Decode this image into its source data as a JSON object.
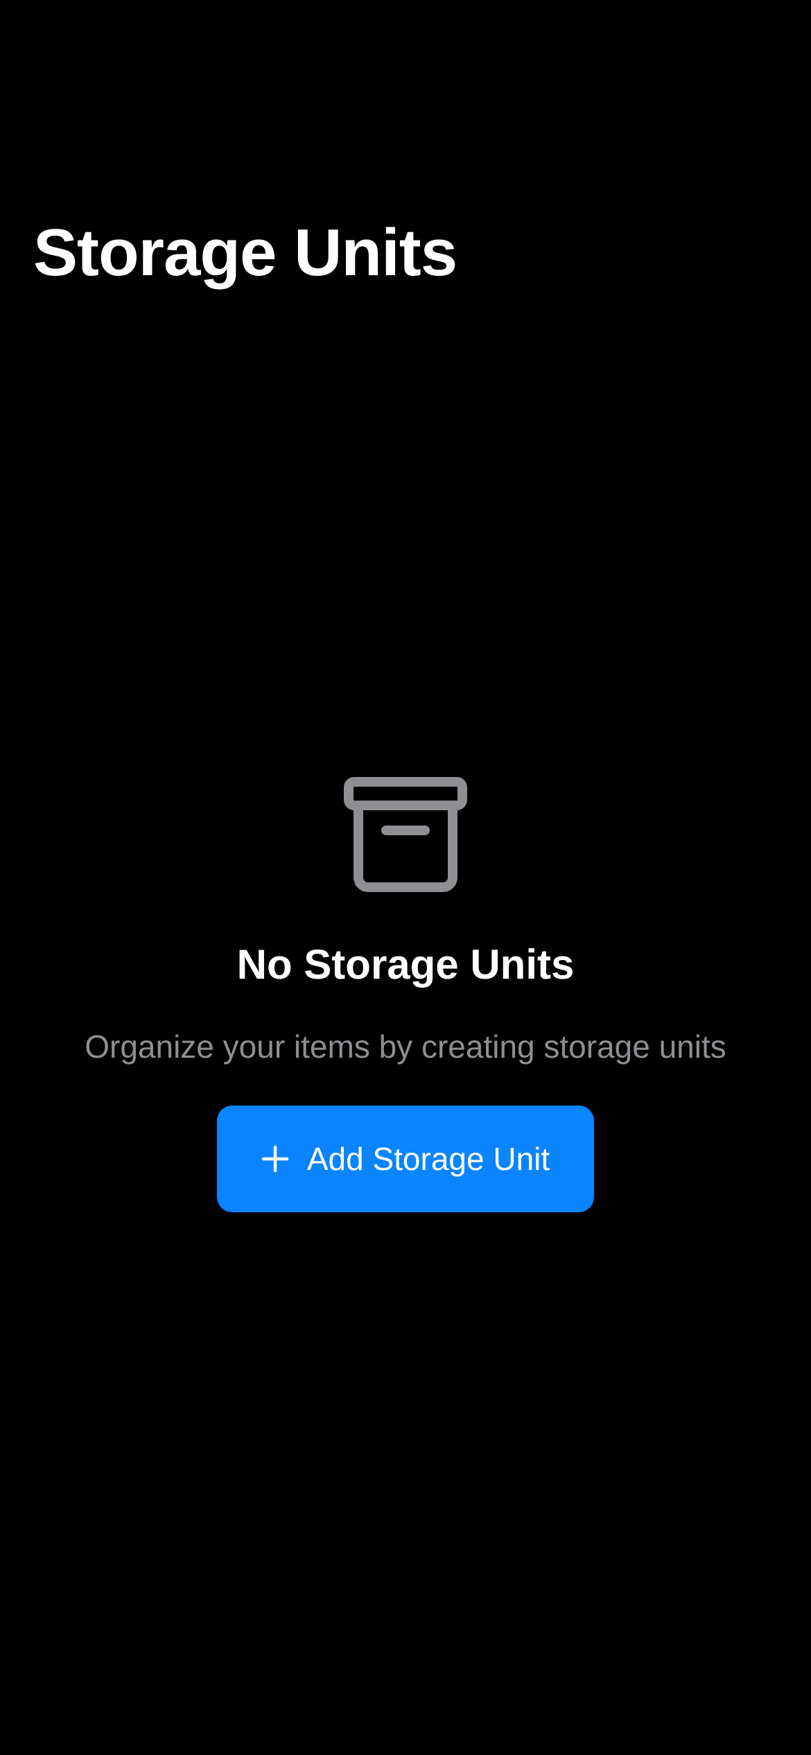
{
  "header": {
    "title": "Storage Units"
  },
  "empty_state": {
    "icon": "archive-box-icon",
    "title": "No Storage Units",
    "subtitle": "Organize your items by creating storage units",
    "button": {
      "icon": "plus-icon",
      "label": "Add Storage Unit"
    }
  },
  "colors": {
    "background": "#000000",
    "accent": "#0a84ff",
    "secondary_text": "#8e8e93",
    "icon_gray": "#8e8e93"
  }
}
